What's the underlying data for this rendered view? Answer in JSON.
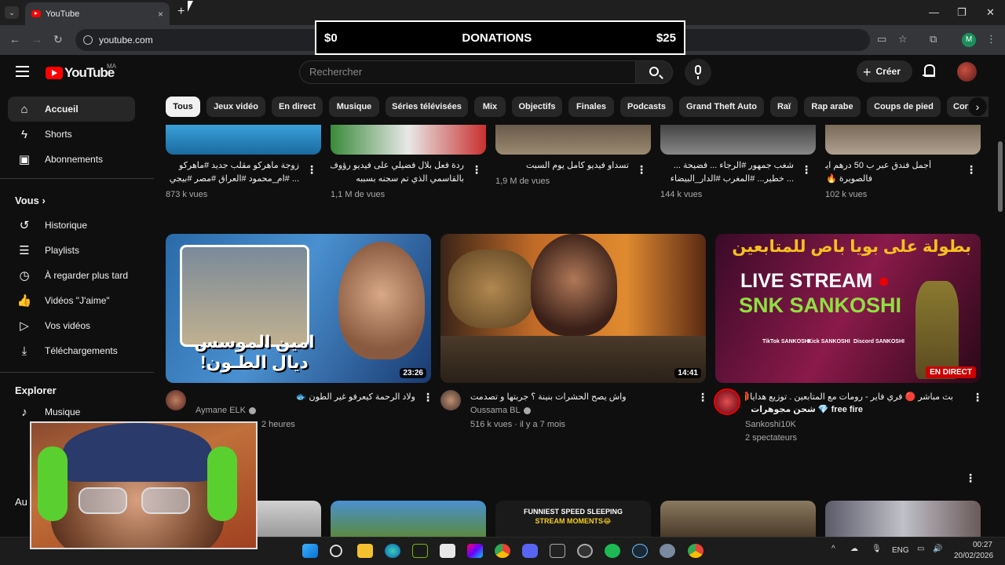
{
  "browser": {
    "tab_title": "YouTube",
    "tab_close": "×",
    "new_tab": "+",
    "url": "youtube.com",
    "profile_initial": "M"
  },
  "donation": {
    "left": "$0",
    "title": "DONATIONS",
    "right": "$25"
  },
  "header": {
    "region": "MA",
    "logo_text": "YouTube",
    "search_placeholder": "Rechercher",
    "create_label": "Créer"
  },
  "sidebar": {
    "main": [
      {
        "label": "Accueil",
        "icon": "home-icon"
      },
      {
        "label": "Shorts",
        "icon": "shorts-icon"
      },
      {
        "label": "Abonnements",
        "icon": "subscriptions-icon"
      }
    ],
    "you_heading": "Vous",
    "you": [
      {
        "label": "Historique",
        "icon": "history-icon"
      },
      {
        "label": "Playlists",
        "icon": "playlists-icon"
      },
      {
        "label": "À regarder plus tard",
        "icon": "watch-later-icon"
      },
      {
        "label": "Vidéos \"J'aime\"",
        "icon": "like-icon"
      },
      {
        "label": "Vos vidéos",
        "icon": "your-videos-icon"
      },
      {
        "label": "Téléchargements",
        "icon": "download-icon"
      }
    ],
    "explore_heading": "Explorer",
    "explore": [
      {
        "label": "Musique",
        "icon": "music-icon"
      }
    ],
    "partial_heading": "Au"
  },
  "chips": [
    "Tous",
    "Jeux vidéo",
    "En direct",
    "Musique",
    "Séries télévisées",
    "Mix",
    "Objectifs",
    "Finales",
    "Podcasts",
    "Grand Theft Auto",
    "Raï",
    "Rap arabe",
    "Coups de pied",
    "Con"
  ],
  "row1": [
    {
      "title1": "زوجة ماهركو مقلب جديد #ماهركو",
      "title2": "... #ام_محمود #العراق #مصر #بيجي",
      "meta": "873 k vues"
    },
    {
      "title1": "ردة فعل بلال فضيلي على فيديو رؤوف",
      "title2": "بالقاسمي الذي تم سجنه بسببه",
      "meta": "1,1 M de vues"
    },
    {
      "title1": "تسداو فيديو كامل يوم السبت",
      "title2": "",
      "meta": "1,9 M de vues"
    },
    {
      "title1": "شغب جمهور #الرجاء ... فضيحة ...",
      "title2": "... خطير... #المغرب #الدار_البيضاء",
      "meta": "144 k vues"
    },
    {
      "title1": "أجمل فندق عبر ب 50 درهم ايلا",
      "title2": "فالصويرة 🔥 ✌️",
      "meta": "102 k vues"
    }
  ],
  "row2": [
    {
      "title": "ولاد الرحمة كيعرفو غير الطون 🐟",
      "channel": "Aymane ELK",
      "meta": "2 heures",
      "duration": "23:26",
      "thumb_text": "امين الموسس ديال الطـون!"
    },
    {
      "title": "واش يصح الحشرات بنينة ؟ جربتها و تصدمت",
      "channel": "Oussama BL",
      "meta": "516 k vues · il y a 7 mois",
      "duration": "14:41"
    },
    {
      "title": "بث مباشر 🔴 فري فاير - رومات مع المتابعين . توزيع هدايا🎁",
      "title_line2": "free fire 💎 شحن مجوهرات",
      "channel": "Sankoshi10K",
      "meta": "2 spectateurs",
      "live_badge": "EN DIRECT",
      "thumb_top": "بطولة على بويا باص للمتابعين",
      "thumb_live": "LIVE STREAM",
      "thumb_name": "SNK SANKOSHI",
      "socials": [
        "TikTok SANKOSHI",
        "Kick SANKOSHI",
        "Discord SANKOSHI"
      ]
    }
  ],
  "row3_thumb_text": {
    "line1": "FUNNIEST SPEED SLEEPING",
    "line2": "STREAM MOMENTS😂"
  },
  "tray": {
    "lang": "ENG",
    "time": "00:27",
    "date": "20/02/2026"
  }
}
